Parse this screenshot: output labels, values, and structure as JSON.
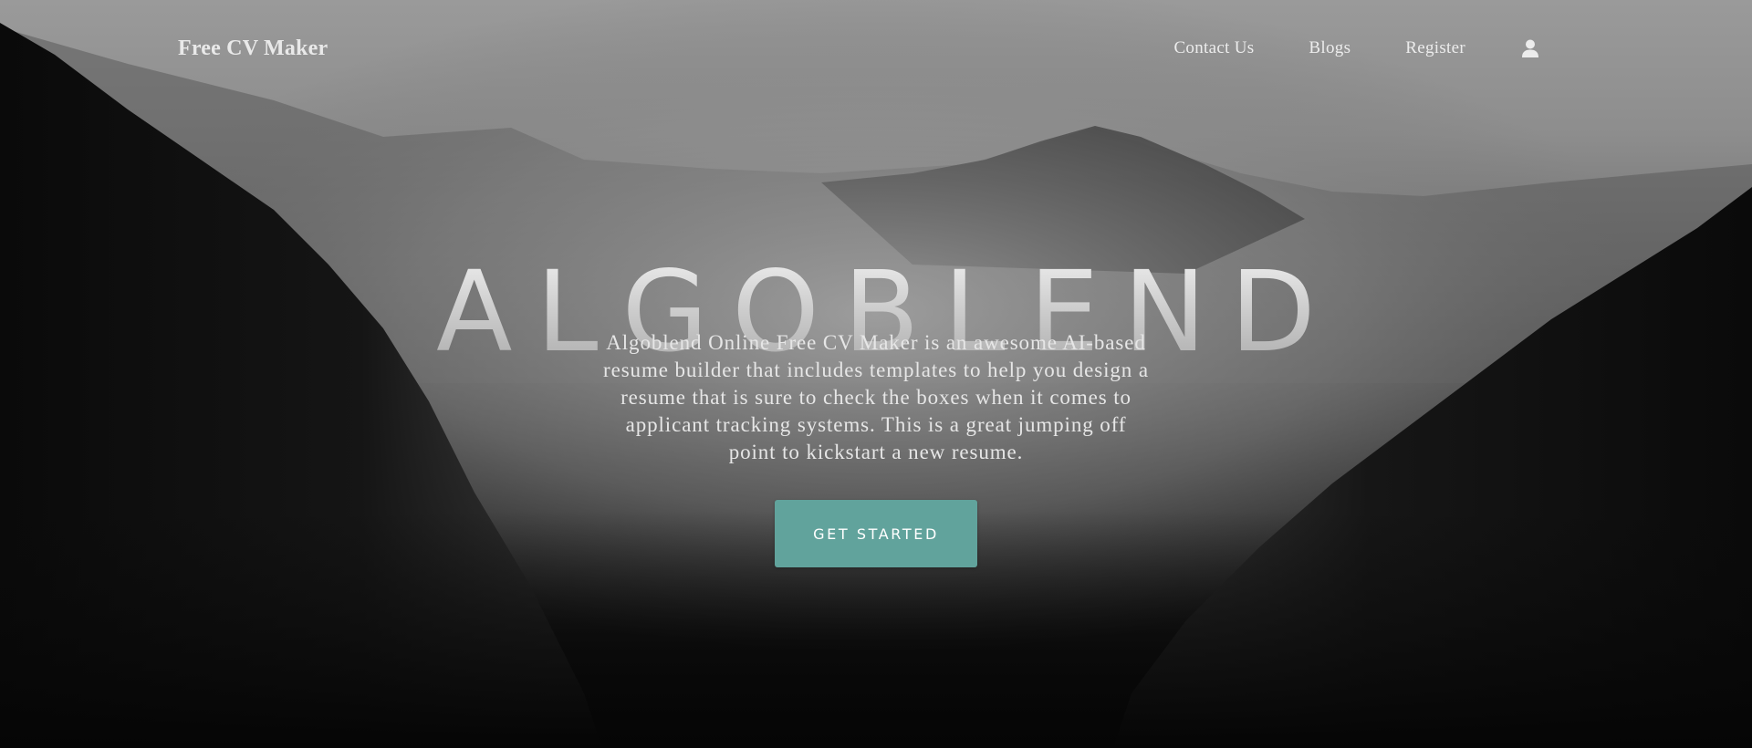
{
  "navbar": {
    "brand": "Free CV Maker",
    "links": [
      {
        "label": "Contact Us"
      },
      {
        "label": "Blogs"
      },
      {
        "label": "Register"
      }
    ],
    "user_icon": "user-icon"
  },
  "hero": {
    "headline": "ALGOBLEND",
    "description": "Algoblend Online Free CV Maker is an awesome AI-based resume builder that includes templates to help you design a resume that is sure to check the boxes when it comes to applicant tracking systems. This is a great jumping off point to kickstart a new resume.",
    "cta_label": "GET STARTED",
    "accent_color": "#61a39c"
  }
}
